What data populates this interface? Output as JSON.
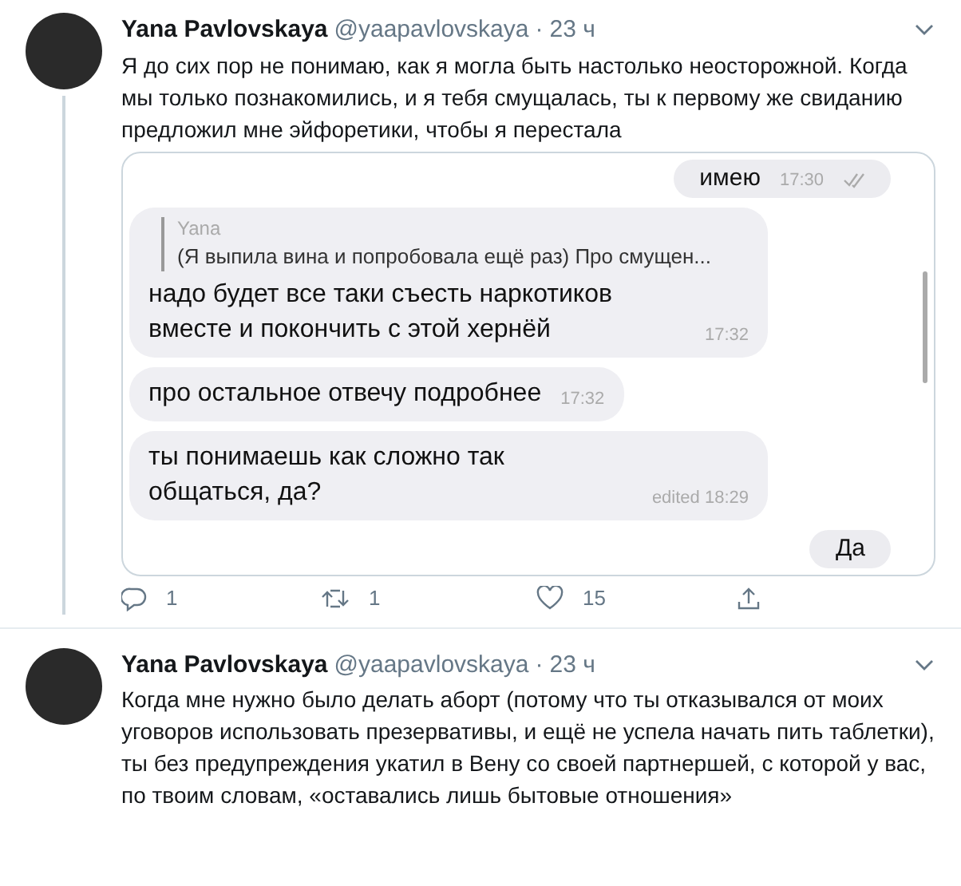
{
  "tweets": [
    {
      "author": "Yana Pavlovskaya",
      "handle": "@yaapavlovskaya",
      "time": "23 ч",
      "separator": "·",
      "thread_line": true,
      "text": "Я до сих пор не понимаю, как я могла быть настолько неосторожной. Когда мы только познакомились, и я тебя смущалась, ты к первому же свиданию предложил мне эйфоретики, чтобы я перестала",
      "chat": [
        {
          "kind": "outgoing",
          "text": "имею",
          "time": "17:30"
        },
        {
          "kind": "incoming",
          "quote_author": "Yana",
          "quote_text": "(Я выпила вина и попробовала ещё раз) Про смущен...",
          "text": "надо будет все таки съесть наркотиков вместе и покончить с этой хернёй",
          "time": "17:32"
        },
        {
          "kind": "incoming",
          "text": "про остальное отвечу подробнее",
          "time": "17:32"
        },
        {
          "kind": "incoming",
          "text": "ты понимаешь как сложно так общаться, да?",
          "time": "edited 18:29"
        },
        {
          "kind": "outgoing",
          "text": "Да"
        }
      ],
      "actions": {
        "replies": "1",
        "retweets": "1",
        "likes": "15"
      }
    },
    {
      "author": "Yana Pavlovskaya",
      "handle": "@yaapavlovskaya",
      "time": "23 ч",
      "separator": "·",
      "thread_line": false,
      "text": "Когда мне нужно было делать аборт (потому что ты отказывался от моих уговоров использовать презервативы, и ещё не успела начать пить таблетки), ты без предупреждения укатил в Вену со своей партнершей, с которой у вас, по твоим словам, «оставались лишь бытовые отношения»"
    }
  ]
}
